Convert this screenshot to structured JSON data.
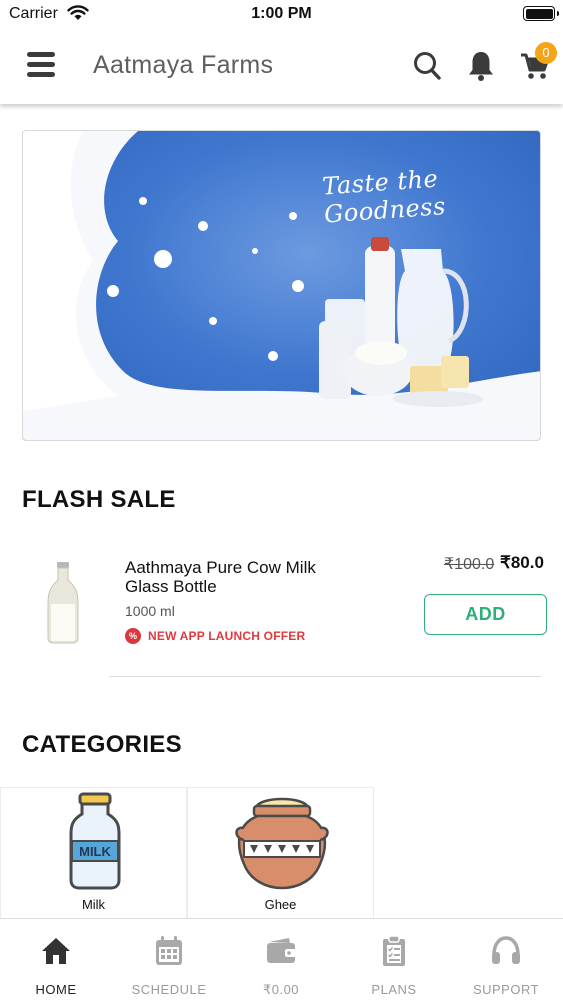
{
  "status_bar": {
    "carrier": "Carrier",
    "time": "1:00 PM"
  },
  "header": {
    "title": "Aatmaya Farms",
    "cart_count": "0"
  },
  "banner": {
    "tagline": "Taste the Goodness"
  },
  "flash_sale": {
    "title": "FLASH SALE",
    "product": {
      "name": "Aathmaya Pure Cow Milk Glass Bottle",
      "quantity": "1000 ml",
      "offer": "NEW APP LAUNCH OFFER",
      "offer_icon_text": "%",
      "old_price": "₹100.0",
      "price": "₹80.0",
      "add_label": "ADD"
    }
  },
  "categories": {
    "title": "CATEGORIES",
    "items": [
      {
        "label": "Milk",
        "icon": "milk-bottle-icon",
        "bottle_text": "MILK"
      },
      {
        "label": "Ghee",
        "icon": "ghee-pot-icon"
      }
    ]
  },
  "tab_bar": {
    "active": "HOME",
    "tabs": [
      {
        "label": "HOME",
        "icon": "home-icon"
      },
      {
        "label": "SCHEDULE",
        "icon": "calendar-icon"
      },
      {
        "label": "₹0.00",
        "icon": "wallet-icon"
      },
      {
        "label": "PLANS",
        "icon": "clipboard-icon"
      },
      {
        "label": "SUPPORT",
        "icon": "headset-icon"
      }
    ]
  },
  "colors": {
    "accent_green": "#2fae78",
    "offer_red": "#e0393e",
    "badge_orange": "#f5a417",
    "banner_blue": "#3f77cf"
  }
}
